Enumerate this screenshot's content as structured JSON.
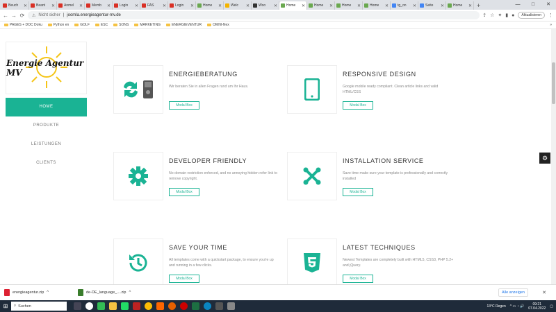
{
  "browser": {
    "tabs": [
      {
        "label": "Beuch",
        "color": "#d93025"
      },
      {
        "label": "Beant",
        "color": "#d93025"
      },
      {
        "label": "Anmel",
        "color": "#d93025"
      },
      {
        "label": "Memb",
        "color": "#d93025"
      },
      {
        "label": "Login",
        "color": "#d93025"
      },
      {
        "label": "FAS",
        "color": "#d93025"
      },
      {
        "label": "Login",
        "color": "#d93025"
      },
      {
        "label": "Home",
        "color": "#6aa84f"
      },
      {
        "label": "Welc",
        "color": "#f4b400"
      },
      {
        "label": "Woo",
        "color": "#333333"
      },
      {
        "label": "Home",
        "color": "#6aa84f",
        "active": true
      },
      {
        "label": "Home",
        "color": "#6aa84f"
      },
      {
        "label": "Home",
        "color": "#6aa84f"
      },
      {
        "label": "Home",
        "color": "#6aa84f"
      },
      {
        "label": "tg_on",
        "color": "#4285f4"
      },
      {
        "label": "Seite",
        "color": "#4285f4"
      },
      {
        "label": "Home",
        "color": "#6aa84f"
      }
    ],
    "new_tab": "+",
    "controls": [
      "—",
      "□",
      "✕"
    ],
    "secure_label": "Nicht sicher",
    "url": "joomla.energieagentur-mv.de",
    "update_label": "Aktualisieren",
    "bookmarks": [
      "PAGES + DOC Doku",
      "Python  en",
      "GOLF",
      "ESC",
      "SONS",
      "MARKETING",
      "ENERGIEVENTUR",
      "OMNI-Nex"
    ],
    "bookmarks_right": "»"
  },
  "site": {
    "logo_text": "Energie Agentur MV",
    "nav": [
      {
        "label": "HOME",
        "active": true
      },
      {
        "label": "PRODUKTE"
      },
      {
        "label": "LEISTUNGEN"
      },
      {
        "label": "CLIENTS"
      }
    ],
    "features": [
      {
        "title": "ENERGIEBERATUNG",
        "desc": "Wir beraten Sie in allen Fragen rund um Ihr Haus.",
        "button": "Modal Box",
        "icon": "energy-icon"
      },
      {
        "title": "RESPONSIVE DESIGN",
        "desc": "Google mobile ready compliant. Clean article links and valid HTML/CSS",
        "button": "Modal Box",
        "icon": "tablet-icon"
      },
      {
        "title": "DEVELOPER FRIENDLY",
        "desc": "No domain restriction enforced, and no annoying hidden refer link to remove copyright.",
        "button": "Modal Box",
        "icon": "gear-icon"
      },
      {
        "title": "INSTALLATION SERVICE",
        "desc": "Save time make sure your template is professionally and correctly installed",
        "button": "Modal Box",
        "icon": "joomla-icon"
      },
      {
        "title": "SAVE YOUR TIME",
        "desc": "All templates come with a quickstart package, to ensure you're up and running in a few clicks.",
        "button": "Modal Box",
        "icon": "history-icon"
      },
      {
        "title": "LATEST TECHNIQUES",
        "desc": "Newest Templates are completely built with HTML5, CSS3, PHP 5.2+ and jQuery.",
        "button": "Modal Box",
        "icon": "html5-icon"
      }
    ],
    "accent": "#1ab394"
  },
  "downloads": {
    "items": [
      "energieagentur.zip",
      "de-DE_language_....zip"
    ],
    "show_all": "Alle anzeigen",
    "close": "✕"
  },
  "taskbar": {
    "search_placeholder": "Suchen",
    "weather": "13°C  Regen",
    "time": "09:21",
    "date": "07.04.2022"
  }
}
